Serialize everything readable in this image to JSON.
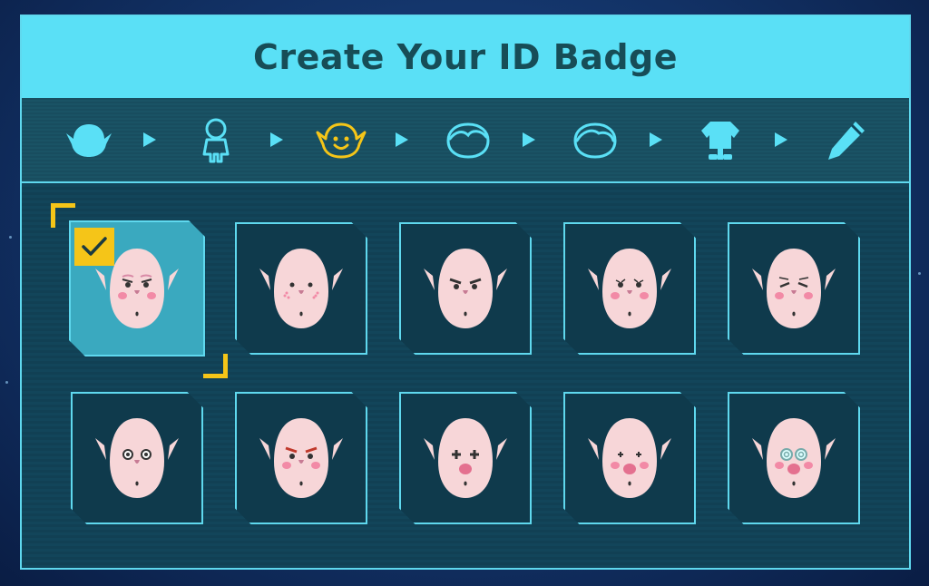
{
  "header": {
    "title": "Create Your ID Badge"
  },
  "steps": [
    {
      "name": "head-shape",
      "icon": "head-shape-icon",
      "active": false
    },
    {
      "name": "body-size",
      "icon": "body-outline-icon",
      "active": false
    },
    {
      "name": "face",
      "icon": "face-icon",
      "active": true
    },
    {
      "name": "hair",
      "icon": "hair-icon",
      "active": false
    },
    {
      "name": "hair-alt",
      "icon": "hair-alt-icon",
      "active": false
    },
    {
      "name": "outfit",
      "icon": "outfit-icon",
      "active": false
    },
    {
      "name": "name",
      "icon": "pencil-icon",
      "active": false
    }
  ],
  "faces": [
    {
      "id": 1,
      "eyes": "stern",
      "cheeks": "blush",
      "selected": true
    },
    {
      "id": 2,
      "eyes": "dots",
      "cheeks": "freckles",
      "selected": false
    },
    {
      "id": 3,
      "eyes": "angry",
      "cheeks": "none",
      "selected": false
    },
    {
      "id": 4,
      "eyes": "lashes",
      "cheeks": "blush",
      "selected": false
    },
    {
      "id": 5,
      "eyes": "closed",
      "cheeks": "blush",
      "selected": false
    },
    {
      "id": 6,
      "eyes": "circles",
      "cheeks": "none",
      "selected": false
    },
    {
      "id": 7,
      "eyes": "fierce",
      "cheeks": "blush",
      "selected": false
    },
    {
      "id": 8,
      "eyes": "crosses",
      "cheeks": "none",
      "selected": false
    },
    {
      "id": 9,
      "eyes": "sparkle",
      "cheeks": "blush",
      "selected": false
    },
    {
      "id": 10,
      "eyes": "spirals",
      "cheeks": "blush",
      "selected": false
    }
  ],
  "colors": {
    "accent": "#5ae0f6",
    "active_step": "#f5c518",
    "skin": "#f7d6d8"
  }
}
